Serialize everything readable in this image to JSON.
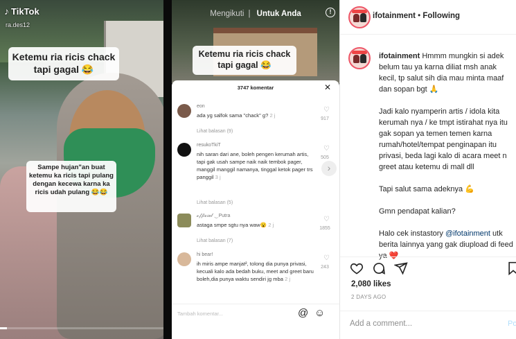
{
  "left_video": {
    "app": "TikTok",
    "username": "ra.des12",
    "caption_top": "Ketemu ria ricis chack tapi gagal 😂",
    "caption_side": "Sampe hujan\"an buat ketemu ka ricis tapi pulang dengan kecewa karna ka ricis udah pulang 😂😂"
  },
  "right_video": {
    "tab_following": "Mengikuti",
    "tab_for_you": "Untuk Anda",
    "caption_top": "Ketemu ria ricis chack tapi gagal 😂",
    "comments_header": "3747 komentar",
    "comments": [
      {
        "name": "eon",
        "text": "ada yg salfok sama \"chack\" g?",
        "ago": "2 j",
        "likes": "917",
        "replies": "Lihat balasan (9)",
        "avatar_color": "#7a5a4a"
      },
      {
        "name": "resukoTkiT",
        "text": "nih saran dari ane, boleh pengen kerumah artis, tapi gak usah sampe naik naik tembok pager, manggil manggil namanya, tinggal ketok pager trs panggil",
        "ago": "3 j",
        "likes": "505",
        "replies": "Lihat balasan (5)",
        "avatar_color": "#111111"
      },
      {
        "name": "𝓸𝒻𝒻𝒾𝒸𝒾𝒶𝓁 ‿Putra",
        "text": "astaga smpe sgtu nya waw😮",
        "ago": "2 j",
        "likes": "1855",
        "replies": "Lihat balasan (7)",
        "avatar_color": "#8b8b5a"
      },
      {
        "name": "hi bear!",
        "text": "ih miris ampe manjat², tolong dia punya privasi, kecuali kalo ada bedah buku, meet and greet baru boleh,dia punya waktu sendiri jg mba",
        "ago": "2 j",
        "likes": "243",
        "replies": "",
        "avatar_color": "#d8b89a"
      }
    ],
    "comment_placeholder": "Tambah komentar...",
    "at_symbol": "@",
    "emoji_symbol": "☺"
  },
  "instagram": {
    "account": "ifotainment",
    "separator": " • ",
    "follow_status": "Following",
    "caption_paragraphs": [
      "Hmmm mungkin si adek belum tau ya karna diliat msh anak kecil, tp salut sih dia mau minta maaf dan sopan bgt 🙏",
      "Jadi kalo nyamperin artis / idola kita kerumah nya / ke tmpt istirahat nya itu gak sopan ya temen temen karna rumah/hotel/tempat penginapan itu privasi, beda lagi kalo di acara meet n greet atau ketemu di mall dll",
      "Tapi salut sama adeknya 💪",
      "Gmn pendapat kalian?"
    ],
    "caption_last_prefix": "Halo cek instastory ",
    "caption_last_tag": "@ifotainment",
    "caption_last_suffix": " utk berita lainnya yang gak diupload di feed ya ❤️",
    "likes": "2,080 likes",
    "posted_ago": "2 DAYS AGO",
    "add_comment_placeholder": "Add a comment...",
    "post_label": "Post",
    "accent_color": "#0095f6",
    "icons": [
      "heart-icon",
      "comment-icon",
      "share-icon",
      "bookmark-icon"
    ]
  }
}
